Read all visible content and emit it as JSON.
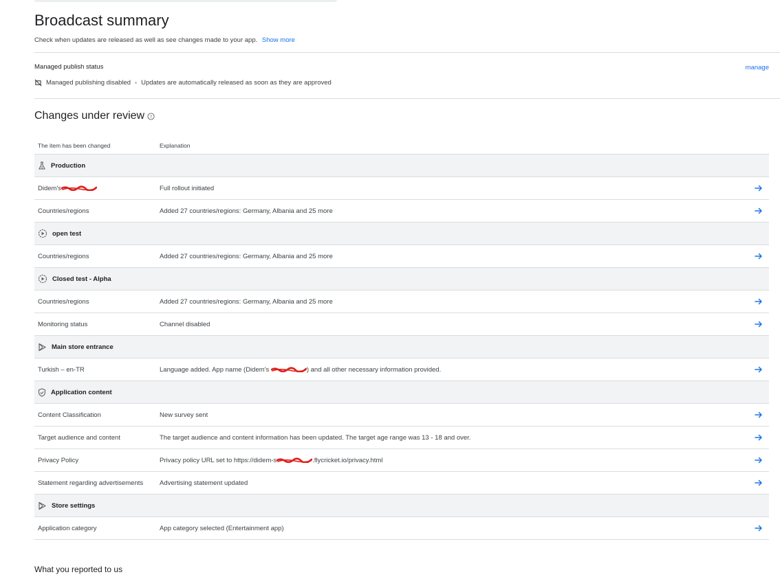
{
  "page": {
    "title": "Broadcast summary",
    "subtitle": "Check when updates are released as well as see changes made to your app.",
    "show_more": "Show more"
  },
  "managed_publish": {
    "label": "Managed publish status",
    "manage_link": "manage",
    "status": "Managed publishing disabled",
    "status_detail": "Updates are automatically released as soon as they are approved",
    "status_icon": "publishing-off-icon"
  },
  "changes": {
    "title": "Changes under review",
    "help_icon": "help-icon",
    "columns": {
      "item": "The item has been changed",
      "explanation": "Explanation"
    },
    "groups": [
      {
        "name": "Production",
        "icon": "flask-icon",
        "rows": [
          {
            "item": "Didem's",
            "explanation": "Full rollout initiated",
            "item_redacted": true
          },
          {
            "item": "Countries/regions",
            "explanation": "Added 27 countries/regions: Germany, Albania and 25 more"
          }
        ]
      },
      {
        "name": "open test",
        "icon": "test-track-icon",
        "rows": [
          {
            "item": "Countries/regions",
            "explanation": "Added 27 countries/regions: Germany, Albania and 25 more"
          }
        ]
      },
      {
        "name": "Closed test - Alpha",
        "icon": "test-track-icon",
        "rows": [
          {
            "item": "Countries/regions",
            "explanation": "Added 27 countries/regions: Germany, Albania and 25 more"
          },
          {
            "item": "Monitoring status",
            "explanation": "Channel disabled"
          }
        ]
      },
      {
        "name": "Main store entrance",
        "icon": "play-store-icon",
        "rows": [
          {
            "item": "Turkish – en-TR",
            "explanation_parts": [
              "Language added. App name (Didem's ",
              ") and all other necessary information provided."
            ]
          }
        ]
      },
      {
        "name": "Application content",
        "icon": "shield-check-icon",
        "rows": [
          {
            "item": "Content Classification",
            "explanation": "New survey sent"
          },
          {
            "item": "Target audience and content",
            "explanation": "The target audience and content information has been updated. The target age range was 13 - 18 and over."
          },
          {
            "item": "Privacy Policy",
            "explanation_parts": [
              "Privacy policy URL set to https://didem-s",
              ".flycricket.io/privacy.html"
            ]
          },
          {
            "item": "Statement regarding advertisements",
            "explanation": "Advertising statement updated"
          }
        ]
      },
      {
        "name": "Store settings",
        "icon": "play-store-icon",
        "rows": [
          {
            "item": "Application category",
            "explanation": "App category selected (Entertainment app)"
          }
        ]
      }
    ]
  },
  "footer": {
    "heading": "What you reported to us"
  },
  "colors": {
    "accent": "#1a73e8",
    "redaction": "#e0201b",
    "group_bg": "#f1f3f4"
  },
  "row_action_icon": "arrow-right-icon"
}
